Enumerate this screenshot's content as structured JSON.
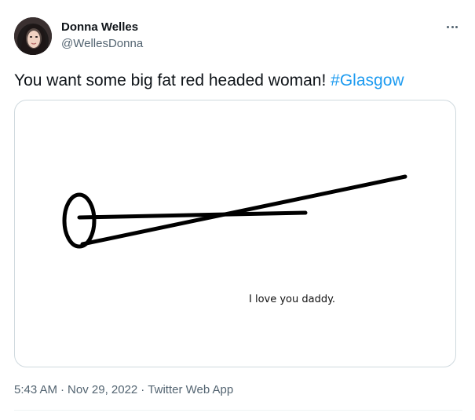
{
  "author": {
    "display_name": "Donna Welles",
    "handle": "@WellesDonna"
  },
  "tweet": {
    "text": "You want some big fat red headed woman! ",
    "hashtag": "#Glasgow",
    "media_caption": "I love you daddy."
  },
  "meta": {
    "time": "5:43 AM",
    "separator": "·",
    "date": "Nov 29, 2022",
    "source": "Twitter Web App"
  },
  "colors": {
    "link": "#1d9bf0",
    "secondary_text": "#536471",
    "border": "#cfd9de"
  },
  "icons": {
    "more": "more-dots-icon"
  }
}
